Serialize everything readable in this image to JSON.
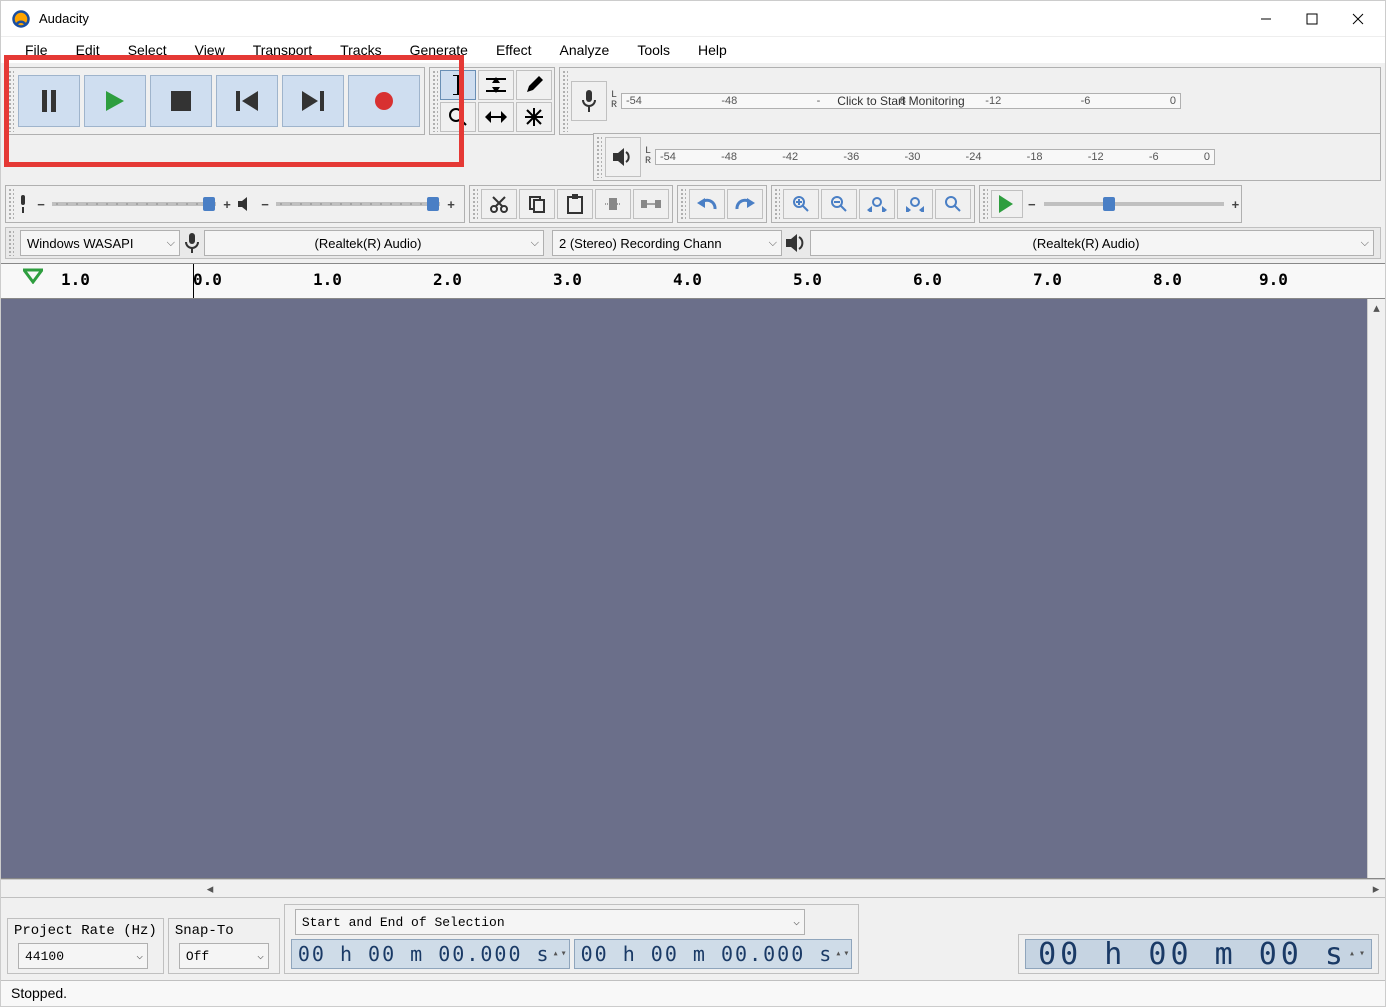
{
  "title": "Audacity",
  "menu": [
    "File",
    "Edit",
    "Select",
    "View",
    "Transport",
    "Tracks",
    "Generate",
    "Effect",
    "Analyze",
    "Tools",
    "Help"
  ],
  "meter": {
    "rec_ticks": [
      "-54",
      "-48",
      "-",
      "",
      "",
      "",
      "",
      "8",
      "-12",
      "-6",
      "0"
    ],
    "rec_monitor": "Click to Start Monitoring",
    "play_ticks": [
      "-54",
      "-48",
      "-42",
      "-36",
      "-30",
      "-24",
      "-18",
      "-12",
      "-6",
      "0"
    ],
    "L": "L",
    "R": "R"
  },
  "device": {
    "host": "Windows WASAPI",
    "rec_dev": "(Realtek(R) Audio)",
    "channels": "2 (Stereo) Recording Chann",
    "play_dev": "(Realtek(R) Audio)"
  },
  "ruler": {
    "labels": [
      "1.0",
      "0.0",
      "1.0",
      "2.0",
      "3.0",
      "4.0",
      "5.0",
      "6.0",
      "7.0",
      "8.0",
      "9.0"
    ]
  },
  "selection": {
    "project_rate_label": "Project Rate (Hz)",
    "project_rate": "44100",
    "snap_label": "Snap-To",
    "snap": "Off",
    "mode": "Start and End of Selection",
    "time1": "00 h 00 m 00.000 s",
    "time2": "00 h 00 m 00.000 s",
    "big_time": "00 h 00 m 00 s"
  },
  "status": "Stopped."
}
